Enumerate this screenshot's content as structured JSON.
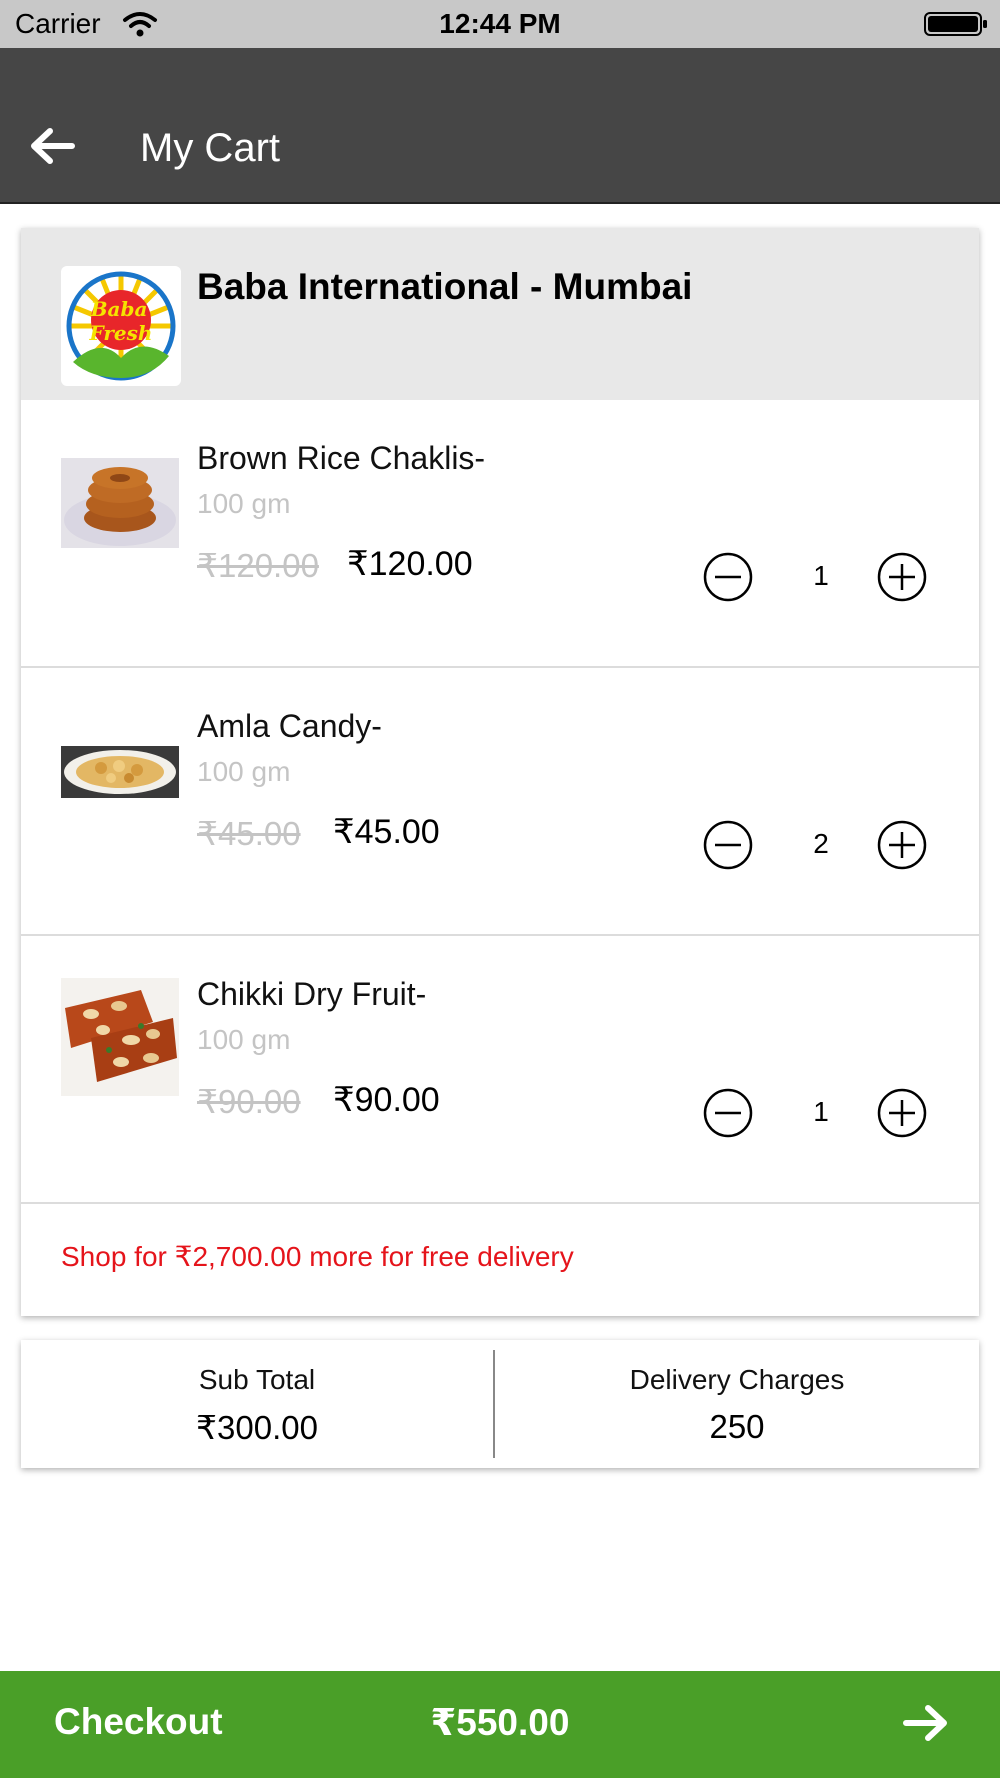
{
  "status_bar": {
    "carrier": "Carrier",
    "time": "12:44 PM"
  },
  "header": {
    "title": "My Cart"
  },
  "store": {
    "name": "Baba International - Mumbai",
    "logo_text": "Baba Fresh"
  },
  "items": [
    {
      "name": "Brown Rice Chaklis-",
      "unit": "100 gm",
      "original_price": "₹120.00",
      "price": "₹120.00",
      "quantity": "1",
      "thumb": "chakli-image"
    },
    {
      "name": "Amla Candy-",
      "unit": "100 gm",
      "original_price": "₹45.00",
      "price": "₹45.00",
      "quantity": "2",
      "thumb": "amla-candy-image"
    },
    {
      "name": "Chikki Dry Fruit-",
      "unit": "100 gm",
      "original_price": "₹90.00",
      "price": "₹90.00",
      "quantity": "1",
      "thumb": "chikki-image"
    }
  ],
  "free_delivery_note": "Shop for ₹2,700.00 more for free delivery",
  "totals": {
    "sub_total_label": "Sub Total",
    "sub_total_value": "₹300.00",
    "delivery_label": "Delivery Charges",
    "delivery_value": "250"
  },
  "checkout": {
    "label": "Checkout",
    "total": "₹550.00"
  },
  "colors": {
    "header_bg": "#464646",
    "status_bg": "#c8c8c8",
    "checkout_bg": "#4a9f28",
    "warning_text": "#e5141b",
    "muted_text": "#c4c4c4"
  }
}
